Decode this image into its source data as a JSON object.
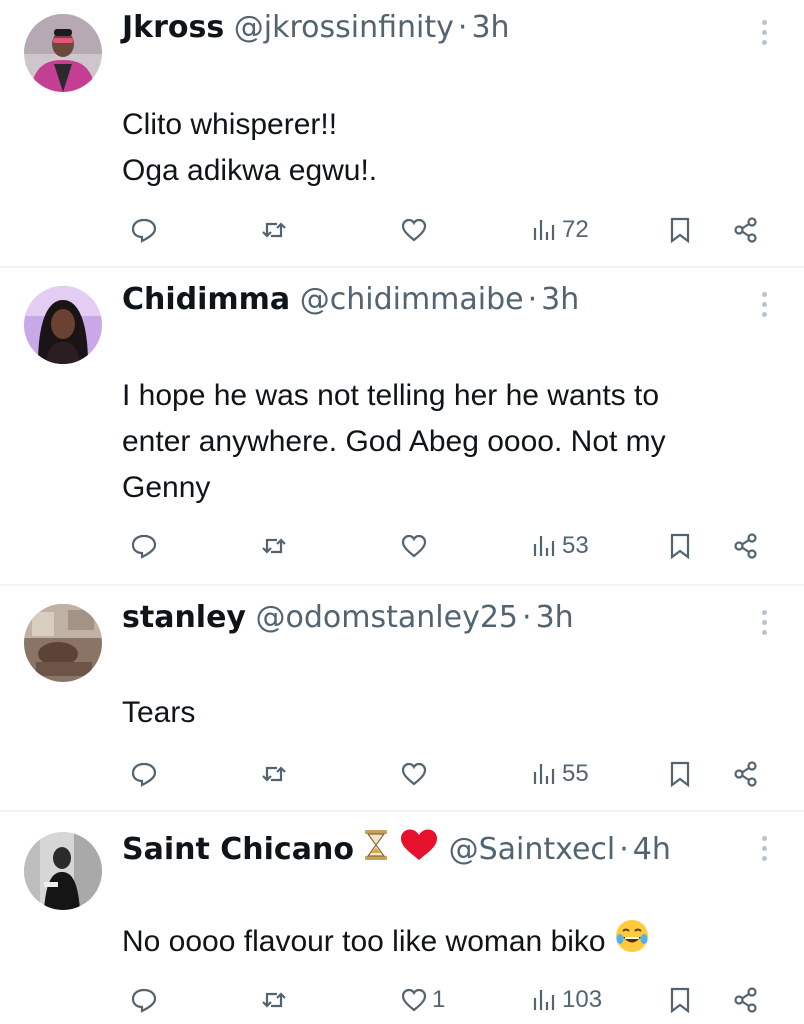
{
  "tweets": [
    {
      "name": "Jkross",
      "handle": "@jkrossinfinity",
      "separator": "·",
      "time": "3h",
      "lines": [
        "Clito whisperer!!",
        "Oga adikwa egwu!."
      ],
      "likes": "",
      "views": "72",
      "avatar_icon": "avatar-pink-jacket"
    },
    {
      "name": "Chidimma",
      "handle": "@chidimmaibe",
      "separator": "·",
      "time": "3h",
      "lines": [
        "I hope he was not telling her he wants to",
        "enter anywhere. God Abeg oooo. Not my",
        "Genny"
      ],
      "likes": "",
      "views": "53",
      "avatar_icon": "avatar-woman"
    },
    {
      "name": "stanley",
      "handle": "@odomstanley25",
      "separator": "·",
      "time": "3h",
      "lines": [
        "Tears"
      ],
      "likes": "",
      "views": "55",
      "avatar_icon": "avatar-room"
    },
    {
      "name": "Saint Chicano",
      "name_emojis": [
        "hourglass-icon",
        "red-heart-icon"
      ],
      "handle": "@Saintxecl",
      "separator": "·",
      "time": "4h",
      "lines": [
        "No oooo flavour too like woman biko"
      ],
      "trailing_emoji": "tears-of-joy-emoji",
      "likes": "1",
      "views": "103",
      "avatar_icon": "avatar-bw-portrait"
    }
  ],
  "colors": {
    "text": "#0f1419",
    "secondary": "#536471",
    "divider": "#eff3f4",
    "heart_red": "#e8112d"
  }
}
